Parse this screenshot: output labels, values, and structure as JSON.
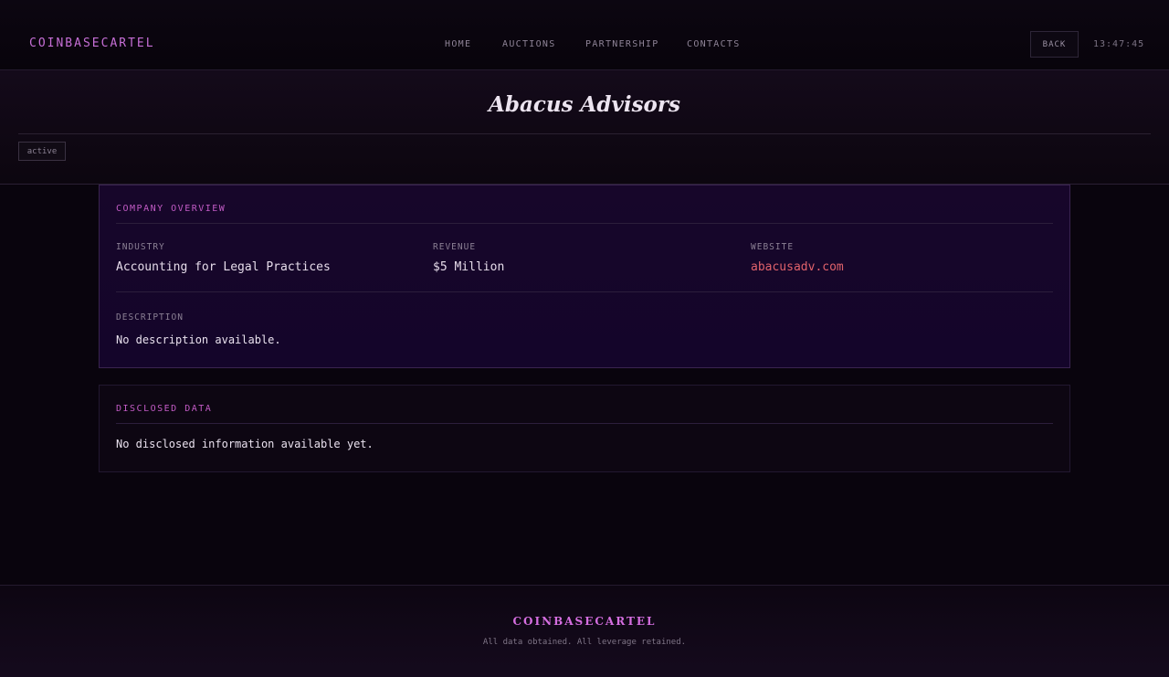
{
  "header": {
    "logo": "COINBASECARTEL",
    "nav": [
      {
        "label": "HOME"
      },
      {
        "label": "AUCTIONS"
      },
      {
        "label": "PARTNERSHIP"
      },
      {
        "label": "CONTACTS"
      }
    ],
    "back_label": "BACK",
    "clock": "13:47:45"
  },
  "company": {
    "name": "Abacus Advisors",
    "status": "active"
  },
  "overview": {
    "heading": "COMPANY OVERVIEW",
    "industry_label": "INDUSTRY",
    "industry_value": "Accounting for Legal Practices",
    "revenue_label": "REVENUE",
    "revenue_value": "$5 Million",
    "website_label": "WEBSITE",
    "website_value": "abacusadv.com",
    "description_label": "DESCRIPTION",
    "description_value": "No description available."
  },
  "disclosed": {
    "heading": "DISCLOSED DATA",
    "text": "No disclosed information available yet."
  },
  "footer": {
    "brand": "COINBASECARTEL",
    "tagline": "All data obtained. All leverage retained."
  },
  "colors": {
    "accent": "#c66fd6",
    "link": "#e0626b",
    "background": "#09040d"
  }
}
